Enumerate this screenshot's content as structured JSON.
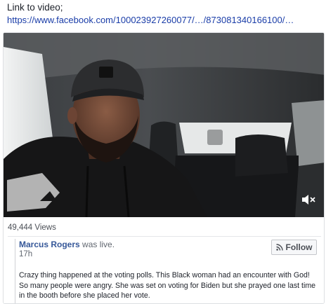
{
  "intro": {
    "label": "Link to video;",
    "url": "https://www.facebook.com/100023927260077/…/873081340166100/…"
  },
  "video": {
    "mute_icon": "speaker-muted-icon",
    "cap_badge_icon": "cap-emblem",
    "overlay_colors": {
      "dark": "#1b1c1e"
    }
  },
  "stats": {
    "views": "49,444 Views"
  },
  "post": {
    "author": "Marcus Rogers",
    "status": "was live.",
    "time": "17h",
    "follow_label": "Follow",
    "follow_icon": "rss-icon",
    "text": "Crazy thing happened at the voting polls. This Black woman had an encounter with God! So many people were angry. She was set on voting for Biden but she prayed one last time in the booth before she placed her vote."
  },
  "colors": {
    "link": "#1a3da8",
    "author": "#365899",
    "muted": "#616770"
  }
}
